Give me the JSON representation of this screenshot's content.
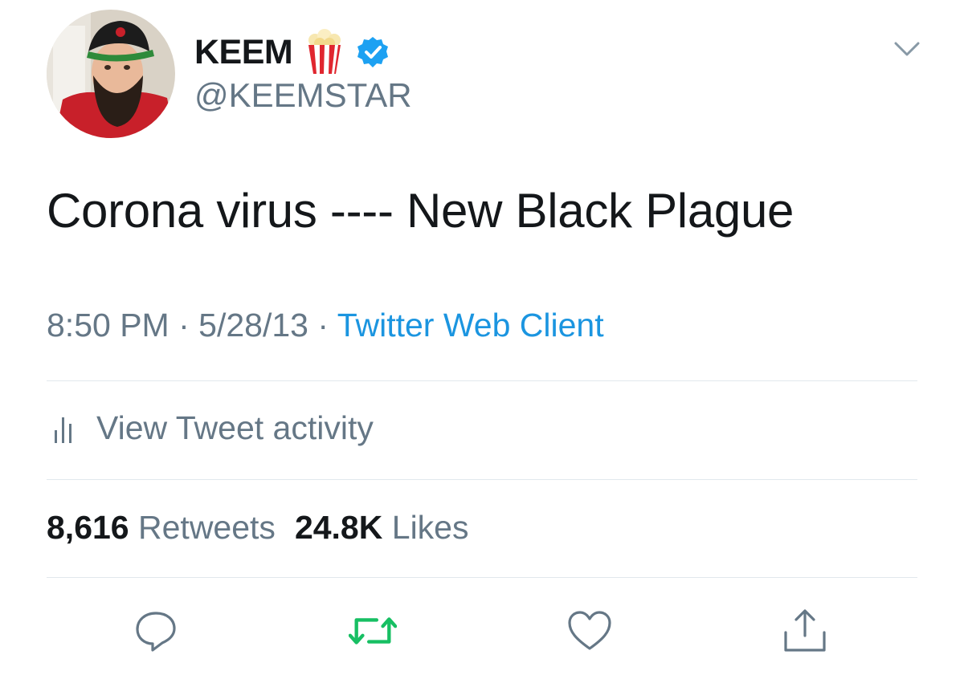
{
  "user": {
    "display_name": "KEEM",
    "name_emoji": "popcorn-emoji",
    "verified_badge": "verified-badge-icon",
    "handle": "@KEEMSTAR"
  },
  "tweet": {
    "text": "Corona virus ---- New Black Plague",
    "time": "8:50 PM",
    "separator": "·",
    "date": "5/28/13",
    "source": "Twitter Web Client"
  },
  "activity": {
    "icon": "bar-chart-icon",
    "label": "View Tweet activity"
  },
  "stats": {
    "retweets_count": "8,616",
    "retweets_label": "Retweets",
    "likes_count": "24.8K",
    "likes_label": "Likes"
  },
  "actions": [
    {
      "name": "reply",
      "icon": "reply-icon"
    },
    {
      "name": "retweet",
      "icon": "retweet-icon"
    },
    {
      "name": "like",
      "icon": "heart-icon"
    },
    {
      "name": "share",
      "icon": "share-icon"
    }
  ],
  "colors": {
    "text_primary": "#14171a",
    "text_secondary": "#657786",
    "link_blue": "#1b95e0",
    "verified_blue": "#1da1f2",
    "retweet_green": "#17bf63",
    "divider": "#e1e8ed"
  }
}
